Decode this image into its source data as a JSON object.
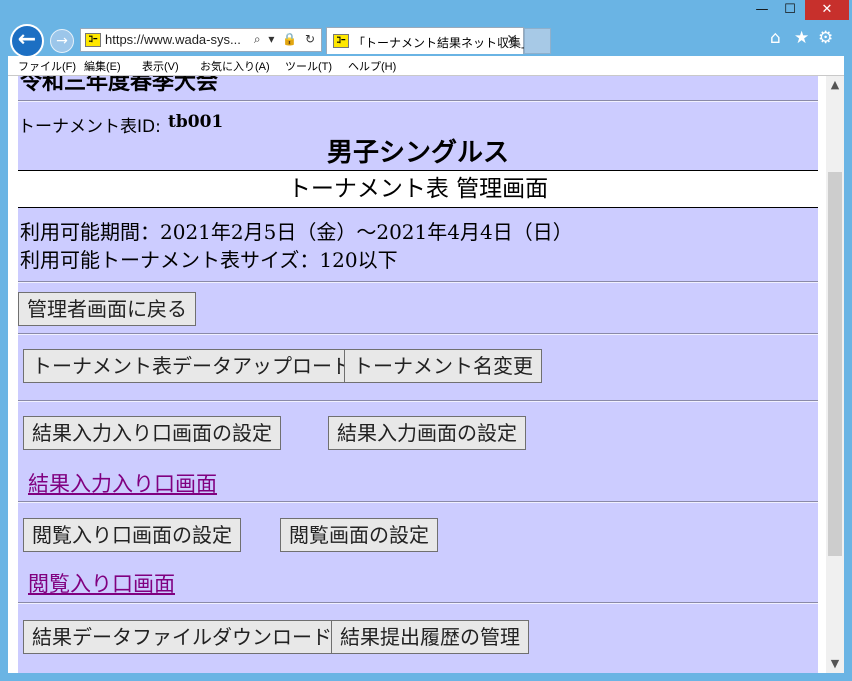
{
  "window": {
    "minimize": "—",
    "maximize": "☐",
    "close": "✕"
  },
  "nav": {
    "address": "https://www.wada-sys...",
    "address_icons": "⌕ ▾ 🔒 ↻",
    "favicon_text": "ｺｰ",
    "tab_title": "「トーナメント結果ネット収集」...",
    "tab_close": "✕"
  },
  "menu": {
    "items": [
      "ファイル(F)",
      "編集(E)",
      "表示(V)",
      "お気に入り(A)",
      "ツール(T)",
      "ヘルプ(H)"
    ]
  },
  "page": {
    "event_name": "令和三年度春季大会",
    "tournament_id_label": "トーナメント表ID:",
    "tournament_id": "tb001",
    "category": "男子シングルス",
    "heading": "トーナメント表 管理画面",
    "availability": "利用可能期間：2021年2月5日（金）～2021年4月4日（日）",
    "size": "利用可能トーナメント表サイズ：120以下",
    "back_button": "管理者画面に戻る",
    "upload_button": "トーナメント表データアップロード",
    "rename_button": "トーナメント名変更",
    "entry_settings_button": "結果入力入り口画面の設定",
    "input_settings_button": "結果入力画面の設定",
    "entry_link": "結果入力入り口画面",
    "view_entry_settings_button": "閲覧入り口画面の設定",
    "view_settings_button": "閲覧画面の設定",
    "view_entry_link": "閲覧入り口画面",
    "download_button": "結果データファイルダウンロード",
    "history_button": "結果提出履歴の管理"
  }
}
